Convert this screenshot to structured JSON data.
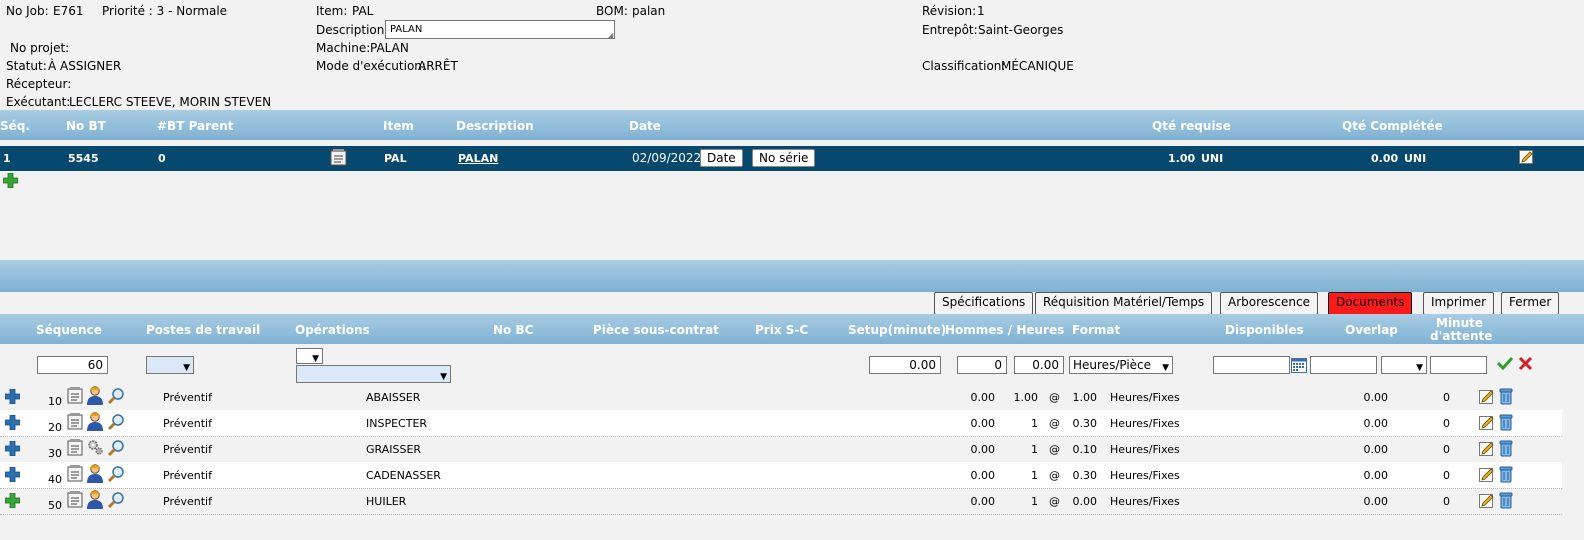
{
  "header": {
    "job_label": "No Job:",
    "job_value": "E761",
    "priority": "Priorité : 3 - Normale",
    "item_label": "Item:",
    "item_value": "PAL",
    "bom_label": "BOM:",
    "bom_value": "palan",
    "revision_label": "Révision:",
    "revision_value": "1",
    "description_label": "Description:",
    "description_value": "PALAN",
    "entrepot_label": "Entrepôt:",
    "entrepot_value": "Saint-Georges",
    "projet_label": "No projet:",
    "projet_value": "",
    "machine_label": "Machine:",
    "machine_value": "PALAN",
    "statut_label": "Statut:",
    "statut_value": "À ASSIGNER",
    "mode_label": "Mode d'exécution:",
    "mode_value": "ARRÊT",
    "classification_label": "Classification:",
    "classification_value": "MÉCANIQUE",
    "recepteur_label": "Récepteur:",
    "recepteur_value": "",
    "executant_label": "Exécutant:",
    "executant_value": "LECLERC STEEVE, MORIN STEVEN"
  },
  "jobs_table": {
    "columns": [
      "Séq.",
      "No BT",
      "#BT Parent",
      "Item",
      "Description",
      "Date",
      "Qté requise",
      "Qté Complétée"
    ],
    "row": {
      "seq": "1",
      "no_bt": "5545",
      "bt_parent": "0",
      "item": "PAL",
      "description": "PALAN",
      "date": "02/09/2022",
      "date_button": "Date",
      "serial_button": "No série",
      "qte_requise": "1.00",
      "qte_requise_unit": "UNI",
      "qte_completee": "0.00",
      "qte_completee_unit": "UNI"
    }
  },
  "toolbar": {
    "specifications": "Spécifications",
    "requisition": "Réquisition Matériel/Temps",
    "arborescence": "Arborescence",
    "documents": "Documents",
    "imprimer": "Imprimer",
    "fermer": "Fermer"
  },
  "ops_table": {
    "columns": {
      "sequence": "Séquence",
      "postes": "Postes de travail",
      "operations": "Opérations",
      "no_bc": "No BC",
      "piece_sc": "Pièce sous-contrat",
      "prix_sc": "Prix S-C",
      "setup": "Setup(minute)",
      "hommes_heures": "Hommes / Heures",
      "format": "Format",
      "disponibles": "Disponibles",
      "overlap": "Overlap",
      "minute_attente_1": "Minute",
      "minute_attente_2": "d'attente"
    },
    "new_row": {
      "sequence": "60",
      "setup": "0.00",
      "hommes": "0",
      "heures": "0.00",
      "format": "Heures/Pièce"
    },
    "rows": [
      {
        "seq": "10",
        "poste": "Préventif",
        "operation": "ABAISSER",
        "setup": "0.00",
        "hommes": "1.00",
        "at": "@",
        "heures": "1.00",
        "format": "Heures/Fixes",
        "overlap": "0.00",
        "attente": "0"
      },
      {
        "seq": "20",
        "poste": "Préventif",
        "operation": "INSPECTER",
        "setup": "0.00",
        "hommes": "1",
        "at": "@",
        "heures": "0.30",
        "format": "Heures/Fixes",
        "overlap": "0.00",
        "attente": "0"
      },
      {
        "seq": "30",
        "poste": "Préventif",
        "operation": "GRAISSER",
        "setup": "0.00",
        "hommes": "1",
        "at": "@",
        "heures": "0.10",
        "format": "Heures/Fixes",
        "overlap": "0.00",
        "attente": "0"
      },
      {
        "seq": "40",
        "poste": "Préventif",
        "operation": "CADENASSER",
        "setup": "0.00",
        "hommes": "1",
        "at": "@",
        "heures": "0.30",
        "format": "Heures/Fixes",
        "overlap": "0.00",
        "attente": "0"
      },
      {
        "seq": "50",
        "poste": "Préventif",
        "operation": "HUILER",
        "setup": "0.00",
        "hommes": "1",
        "at": "@",
        "heures": "0.00",
        "format": "Heures/Fixes",
        "overlap": "0.00",
        "attente": "0"
      }
    ]
  },
  "colors": {
    "band_light": "#a9cce3",
    "band_dark": "#7fb2d3",
    "selected_row": "#07496e",
    "documents_button": "#ff1a1a",
    "add_icon_blue": "#2a6fb0",
    "add_icon_green": "#3aa53a"
  }
}
